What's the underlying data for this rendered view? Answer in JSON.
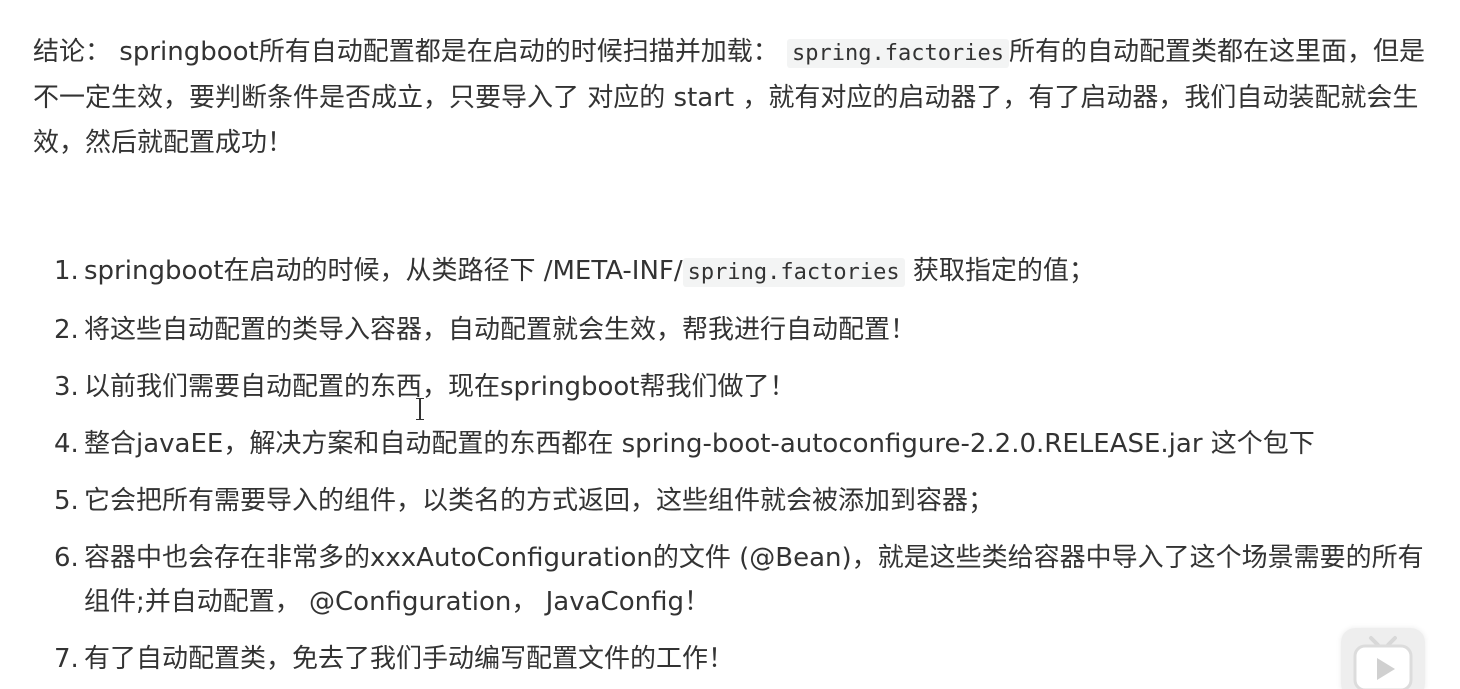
{
  "conclusion": {
    "prefix": "结论：",
    "part1": "springboot所有自动配置都是在启动的时候扫描并加载：",
    "code": "spring.factories",
    "part2": "所有的自动配置类都在这里面，但是不一定生效，要判断条件是否成立，只要导入了 对应的 start ，就有对应的启动器了，有了启动器，我们自动装配就会生效，然后就配置成功！"
  },
  "steps": [
    {
      "num": "1.",
      "before": "springboot在启动的时候，从类路径下 /META-INF/",
      "code": "spring.factories",
      "after": " 获取指定的值；"
    },
    {
      "num": "2.",
      "text": "将这些自动配置的类导入容器，自动配置就会生效，帮我进行自动配置！"
    },
    {
      "num": "3.",
      "text": "以前我们需要自动配置的东西，现在springboot帮我们做了！"
    },
    {
      "num": "4.",
      "text": "整合javaEE，解决方案和自动配置的东西都在 spring-boot-autoconfigure-2.2.0.RELEASE.jar 这个包下"
    },
    {
      "num": "5.",
      "text": "它会把所有需要导入的组件，以类名的方式返回，这些组件就会被添加到容器；"
    },
    {
      "num": "6.",
      "text": "容器中也会存在非常多的xxxAutoConfiguration的文件 (@Bean)，就是这些类给容器中导入了这个场景需要的所有组件;并自动配置，  @Configuration，  JavaConfig！"
    },
    {
      "num": "7.",
      "text": "有了自动配置类，免去了我们手动编写配置文件的工作！"
    }
  ],
  "icons": {
    "text_cursor": "text-cursor-icon",
    "play_widget": "bilibili-tv-icon"
  }
}
